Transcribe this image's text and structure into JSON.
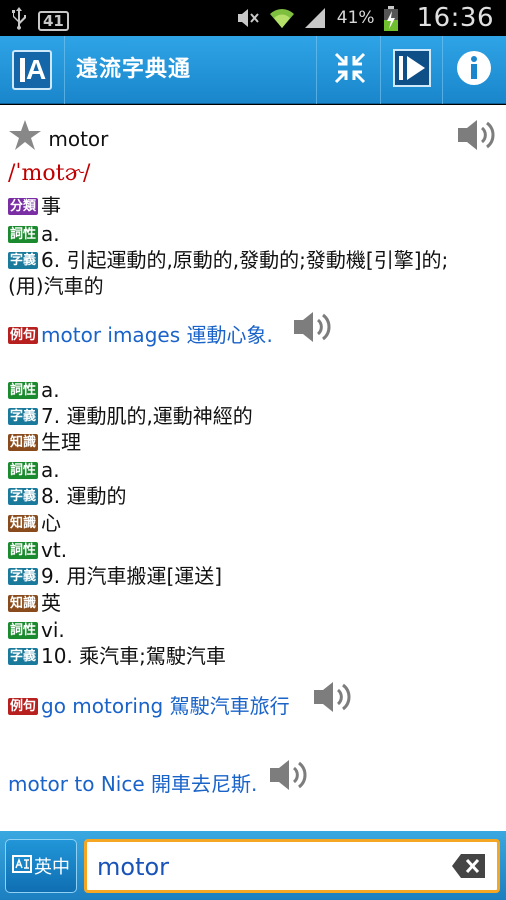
{
  "status_bar": {
    "badge": "41",
    "battery_pct": "41%",
    "time": "16:36"
  },
  "header": {
    "title": "遠流字典通",
    "icons": [
      "app-logo-icon",
      "collapse-icon",
      "play-icon",
      "info-icon"
    ]
  },
  "entry": {
    "word": "motor",
    "phonetic": "/ˈmotɚ/",
    "lines": [
      {
        "tag": "分類",
        "tag_color": "#7a2ea3",
        "text": "事"
      },
      {
        "tag": "詞性",
        "tag_color": "#1b8a2e",
        "text": "a."
      },
      {
        "tag": "字義",
        "tag_color": "#1a7a9c",
        "text": "6. 引起運動的,原動的,發動的;發動機[引擎]的;"
      },
      {
        "tag": "",
        "text": "(用)汽車的"
      },
      {
        "tag": "例句",
        "tag_color": "#b82020",
        "text": "motor images 運動心象.",
        "example": true
      },
      {
        "tag": "詞性",
        "tag_color": "#1b8a2e",
        "text": "a."
      },
      {
        "tag": "字義",
        "tag_color": "#1a7a9c",
        "text": "7. 運動肌的,運動神經的"
      },
      {
        "tag": "知識",
        "tag_color": "#8a4b1c",
        "text": "生理"
      },
      {
        "tag": "詞性",
        "tag_color": "#1b8a2e",
        "text": "a."
      },
      {
        "tag": "字義",
        "tag_color": "#1a7a9c",
        "text": "8. 運動的"
      },
      {
        "tag": "知識",
        "tag_color": "#8a4b1c",
        "text": "心"
      },
      {
        "tag": "詞性",
        "tag_color": "#1b8a2e",
        "text": "vt."
      },
      {
        "tag": "字義",
        "tag_color": "#1a7a9c",
        "text": "9. 用汽車搬運[運送]"
      },
      {
        "tag": "知識",
        "tag_color": "#8a4b1c",
        "text": "英"
      },
      {
        "tag": "詞性",
        "tag_color": "#1b8a2e",
        "text": "vi."
      },
      {
        "tag": "字義",
        "tag_color": "#1a7a9c",
        "text": "10. 乘汽車;駕駛汽車"
      },
      {
        "tag": "例句",
        "tag_color": "#b82020",
        "text": "go motoring 駕駛汽車旅行",
        "example": true
      },
      {
        "tag": "",
        "text": "motor to Nice 開車去尼斯.",
        "example": true
      }
    ]
  },
  "bottom": {
    "lang_label": "英中",
    "search_value": "motor"
  }
}
